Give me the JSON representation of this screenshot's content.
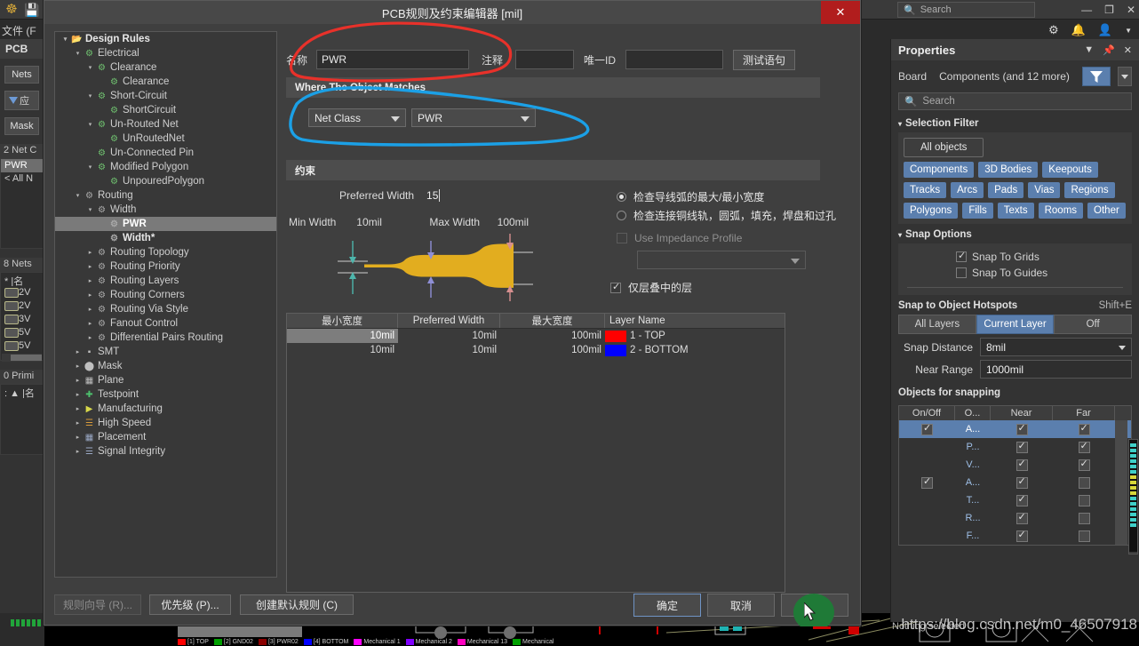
{
  "app": {
    "logo_icon": "altium-logo-icon",
    "save_icon": "save-icon",
    "menu_file": "文件 (F",
    "search_placeholder": "Search",
    "search_icon": "search-icon",
    "minimize": "—",
    "restore": "❐",
    "close": "✕",
    "gear_icon": "gear-icon",
    "bell_icon": "bell-icon",
    "account_icon": "account-icon",
    "chevron_icon": "chevron-down-icon"
  },
  "pcb_panel": {
    "tab": "PCB",
    "nets_button": "Nets",
    "filter_button": "应",
    "mask_button": "Mask",
    "netclass_header": "2 Net C",
    "netclass_items": [
      "PWR",
      "< All N"
    ],
    "nets_header": "8 Nets",
    "nets_col_header": "*   |名",
    "nets_rows": [
      "2V",
      "2V",
      "3V",
      "5V",
      "5V"
    ],
    "primitives_header": "0 Primi",
    "primitives_col_header": ":  ▲ |名"
  },
  "dialog": {
    "title": "PCB规则及约束编辑器 [mil]",
    "close_label": "✕",
    "tree": [
      {
        "indent": 0,
        "arrow": "▾",
        "icon": "folder-icon",
        "label": "Design Rules",
        "bold": true,
        "sel": false
      },
      {
        "indent": 1,
        "arrow": "▾",
        "icon": "rule-icon",
        "label": "Electrical",
        "bold": false,
        "sel": false
      },
      {
        "indent": 2,
        "arrow": "▾",
        "icon": "rule-icon",
        "label": "Clearance",
        "bold": false,
        "sel": false
      },
      {
        "indent": 3,
        "arrow": "",
        "icon": "rule-icon",
        "label": "Clearance",
        "bold": false,
        "sel": false
      },
      {
        "indent": 2,
        "arrow": "▾",
        "icon": "rule-icon",
        "label": "Short-Circuit",
        "bold": false,
        "sel": false
      },
      {
        "indent": 3,
        "arrow": "",
        "icon": "rule-icon",
        "label": "ShortCircuit",
        "bold": false,
        "sel": false
      },
      {
        "indent": 2,
        "arrow": "▾",
        "icon": "rule-icon",
        "label": "Un-Routed Net",
        "bold": false,
        "sel": false
      },
      {
        "indent": 3,
        "arrow": "",
        "icon": "rule-icon",
        "label": "UnRoutedNet",
        "bold": false,
        "sel": false
      },
      {
        "indent": 2,
        "arrow": "",
        "icon": "rule-icon",
        "label": "Un-Connected Pin",
        "bold": false,
        "sel": false
      },
      {
        "indent": 2,
        "arrow": "▾",
        "icon": "rule-icon",
        "label": "Modified Polygon",
        "bold": false,
        "sel": false
      },
      {
        "indent": 3,
        "arrow": "",
        "icon": "rule-icon",
        "label": "UnpouredPolygon",
        "bold": false,
        "sel": false
      },
      {
        "indent": 1,
        "arrow": "▾",
        "icon": "routing-icon",
        "label": "Routing",
        "bold": false,
        "sel": false
      },
      {
        "indent": 2,
        "arrow": "▾",
        "icon": "routing-icon",
        "label": "Width",
        "bold": false,
        "sel": false
      },
      {
        "indent": 3,
        "arrow": "",
        "icon": "routing-icon",
        "label": "PWR",
        "bold": true,
        "sel": true
      },
      {
        "indent": 3,
        "arrow": "",
        "icon": "routing-icon",
        "label": "Width*",
        "bold": true,
        "sel": false
      },
      {
        "indent": 2,
        "arrow": "▸",
        "icon": "routing-icon",
        "label": "Routing Topology",
        "bold": false,
        "sel": false
      },
      {
        "indent": 2,
        "arrow": "▸",
        "icon": "routing-icon",
        "label": "Routing Priority",
        "bold": false,
        "sel": false
      },
      {
        "indent": 2,
        "arrow": "▸",
        "icon": "routing-icon",
        "label": "Routing Layers",
        "bold": false,
        "sel": false
      },
      {
        "indent": 2,
        "arrow": "▸",
        "icon": "routing-icon",
        "label": "Routing Corners",
        "bold": false,
        "sel": false
      },
      {
        "indent": 2,
        "arrow": "▸",
        "icon": "routing-icon",
        "label": "Routing Via Style",
        "bold": false,
        "sel": false
      },
      {
        "indent": 2,
        "arrow": "▸",
        "icon": "routing-icon",
        "label": "Fanout Control",
        "bold": false,
        "sel": false
      },
      {
        "indent": 2,
        "arrow": "▸",
        "icon": "routing-icon",
        "label": "Differential Pairs Routing",
        "bold": false,
        "sel": false
      },
      {
        "indent": 1,
        "arrow": "▸",
        "icon": "smt-icon",
        "label": "SMT",
        "bold": false,
        "sel": false
      },
      {
        "indent": 1,
        "arrow": "▸",
        "icon": "mask-icon",
        "label": "Mask",
        "bold": false,
        "sel": false
      },
      {
        "indent": 1,
        "arrow": "▸",
        "icon": "plane-icon",
        "label": "Plane",
        "bold": false,
        "sel": false
      },
      {
        "indent": 1,
        "arrow": "▸",
        "icon": "testpoint-icon",
        "label": "Testpoint",
        "bold": false,
        "sel": false
      },
      {
        "indent": 1,
        "arrow": "▸",
        "icon": "manufacturing-icon",
        "label": "Manufacturing",
        "bold": false,
        "sel": false
      },
      {
        "indent": 1,
        "arrow": "▸",
        "icon": "highspeed-icon",
        "label": "High Speed",
        "bold": false,
        "sel": false
      },
      {
        "indent": 1,
        "arrow": "▸",
        "icon": "placement-icon",
        "label": "Placement",
        "bold": false,
        "sel": false
      },
      {
        "indent": 1,
        "arrow": "▸",
        "icon": "signal-icon",
        "label": "Signal Integrity",
        "bold": false,
        "sel": false
      }
    ],
    "name_label": "名称",
    "name_value": "PWR",
    "comment_label": "注释",
    "comment_value": "",
    "uid_label": "唯一ID",
    "uid_value": "",
    "test_query_button": "测试语句",
    "where_section": "Where The Object Matches",
    "scope_combo": "Net Class",
    "scope_value_combo": "PWR",
    "constraint_section": "约束",
    "preferred_width_label": "Preferred Width",
    "preferred_width_value": "15",
    "min_width_label": "Min Width",
    "min_width_value": "10mil",
    "max_width_label": "Max Width",
    "max_width_value": "100mil",
    "radio_1": "检查导线弧的最大/最小宽度",
    "radio_2": "检查连接铜线轨，圆弧，填充，焊盘和过孔",
    "radio_selected": 1,
    "impedance_checkbox": "Use Impedance Profile",
    "impedance_combo": "",
    "layers_checkbox": "仅层叠中的层",
    "table": {
      "columns": [
        "最小宽度",
        "Preferred Width",
        "最大宽度",
        "Layer Name"
      ],
      "rows": [
        {
          "min": "10mil",
          "pref": "10mil",
          "max": "100mil",
          "color": "#ff0000",
          "layer": "1 - TOP",
          "selected": true
        },
        {
          "min": "10mil",
          "pref": "10mil",
          "max": "100mil",
          "color": "#0000ff",
          "layer": "2 - BOTTOM",
          "selected": false
        }
      ]
    },
    "footer": {
      "rule_wizard": "规则向导 (R)...",
      "priority": "优先级 (P)...",
      "create_default": "创建默认规则 (C)",
      "ok": "确定",
      "cancel": "取消",
      "apply": "应用"
    },
    "annotations": {
      "red_circle_color": "#e8312a",
      "blue_circle_color": "#1ba0e6",
      "green_highlight_color": "#1f7a37"
    }
  },
  "properties": {
    "title": "Properties",
    "collapse_icon": "chevron-down-icon",
    "pin_icon": "pin-icon",
    "close_icon": "close-icon",
    "board_label": "Board",
    "components_label": "Components (and 12 more)",
    "filter_icon": "funnel-icon",
    "filter_caret_icon": "chevron-down-icon",
    "search_placeholder": "Search",
    "search_icon": "search-icon",
    "selection_filter_title": "Selection Filter",
    "all_objects": "All objects",
    "object_chips": [
      "Components",
      "3D Bodies",
      "Keepouts",
      "Tracks",
      "Arcs",
      "Pads",
      "Vias",
      "Regions",
      "Polygons",
      "Fills",
      "Texts",
      "Rooms",
      "Other"
    ],
    "snap_options_title": "Snap Options",
    "snap_to_grids": "Snap To Grids",
    "snap_to_grids_checked": true,
    "snap_to_guides": "Snap To Guides",
    "snap_to_guides_checked": false,
    "hotspots_title": "Snap to Object Hotspots",
    "hotspots_shortcut": "Shift+E",
    "hotspot_options": [
      "All Layers",
      "Current Layer",
      "Off"
    ],
    "hotspot_selected": "Current Layer",
    "snap_distance_label": "Snap Distance",
    "snap_distance_value": "8mil",
    "near_range_label": "Near Range",
    "near_range_value": "1000mil",
    "objects_for_snapping_title": "Objects for snapping",
    "obj_columns": [
      "On/Off",
      "O...",
      "Near",
      "Far"
    ],
    "obj_rows": [
      {
        "onoff": true,
        "name": "A...",
        "near": true,
        "far": true,
        "selected": true
      },
      {
        "onoff": false,
        "name": "P...",
        "near": true,
        "far": true,
        "selected": false
      },
      {
        "onoff": false,
        "name": "V...",
        "near": true,
        "far": true,
        "selected": false
      },
      {
        "onoff": true,
        "name": "A...",
        "near": true,
        "far": false,
        "selected": false
      },
      {
        "onoff": false,
        "name": "T...",
        "near": true,
        "far": false,
        "selected": false
      },
      {
        "onoff": false,
        "name": "R...",
        "near": true,
        "far": false,
        "selected": false
      },
      {
        "onoff": false,
        "name": "F...",
        "near": true,
        "far": false,
        "selected": false
      }
    ],
    "status": "Nothing selected"
  },
  "watermark": "https://blog.csdn.net/m0_46507918",
  "layer_tabs": [
    {
      "color": "#ff0000",
      "label": "[1] TOP"
    },
    {
      "color": "#00a000",
      "label": "[2] GND02"
    },
    {
      "color": "#8b0000",
      "label": "[3] PWR02"
    },
    {
      "color": "#0000ff",
      "label": "[4] BOTTOM"
    },
    {
      "color": "#ff00ff",
      "label": "Mechanical 1"
    },
    {
      "color": "#8000ff",
      "label": "Mechanical 2"
    },
    {
      "color": "#ff00c0",
      "label": "Mechanical 13"
    },
    {
      "color": "#00a000",
      "label": "Mechanical"
    }
  ]
}
